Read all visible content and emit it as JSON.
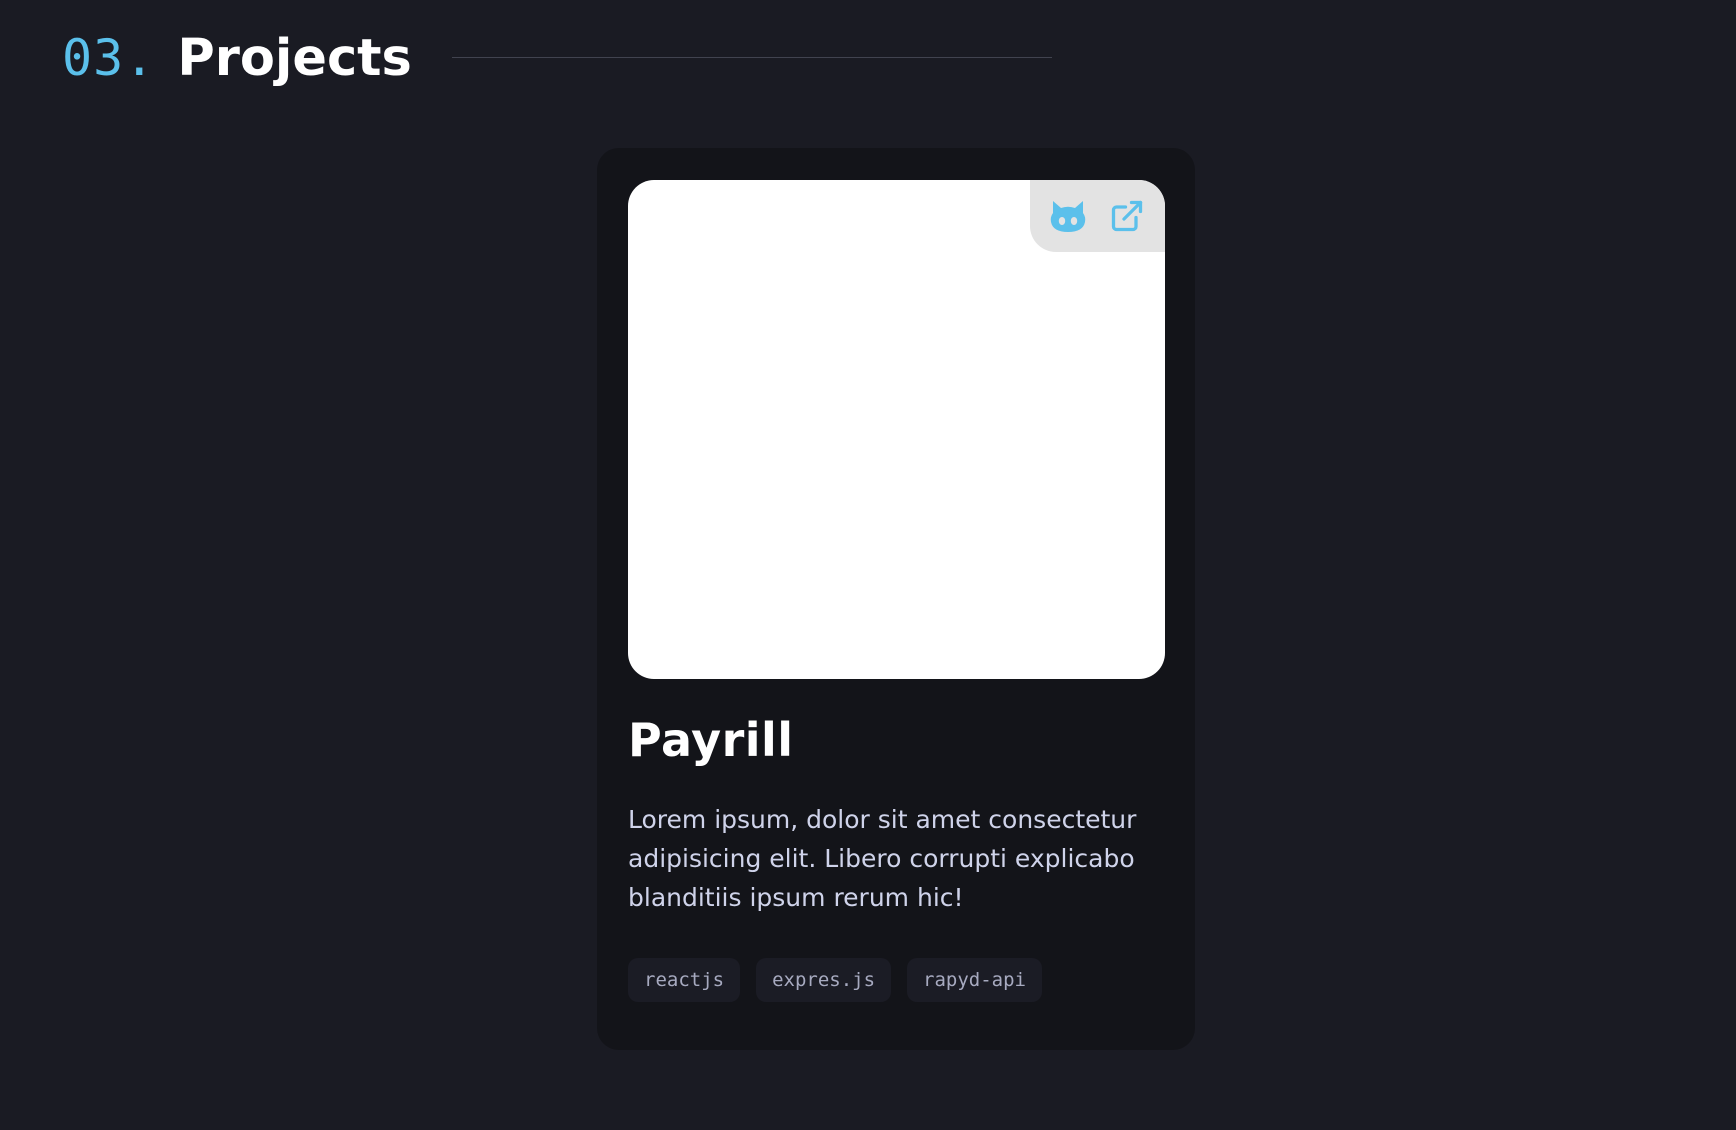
{
  "colors": {
    "background": "#1a1b23",
    "card_background": "#131419",
    "accent": "#5bc0eb",
    "heading": "#ffffff",
    "body_text": "#cfd3ea",
    "tag_background": "#1b1c25",
    "tag_text": "#a7aac0"
  },
  "section": {
    "number": "03.",
    "title": "Projects"
  },
  "project": {
    "title": "Payrill",
    "description": "Lorem ipsum, dolor sit amet consectetur adipisicing elit. Libero corrupti explicabo blanditiis ipsum rerum hic!",
    "links": {
      "github_icon": "github-icon",
      "external_icon": "external-link-icon"
    },
    "tags": [
      "reactjs",
      "expres.js",
      "rapyd-api"
    ]
  }
}
